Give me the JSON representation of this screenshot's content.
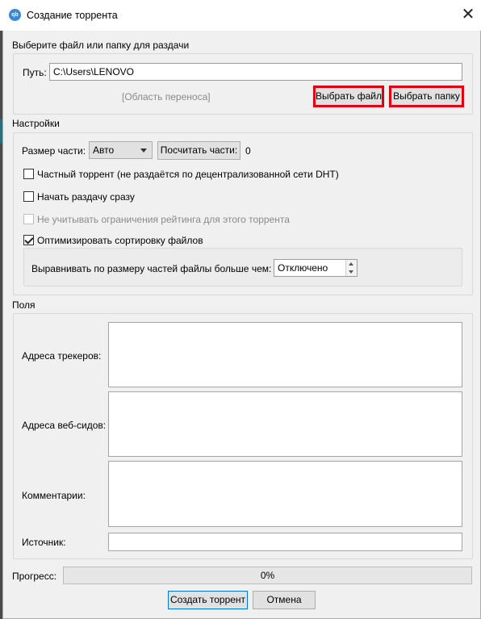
{
  "window": {
    "title": "Создание торрента",
    "icon_text": "qb"
  },
  "source": {
    "heading": "Выберите файл или папку для раздачи",
    "path_label": "Путь:",
    "path_value": "C:\\Users\\LENOVO",
    "drop_area": "[Область переноса]",
    "select_file": "Выбрать файл",
    "select_folder": "Выбрать папку",
    "highlight_color": "#e00012"
  },
  "settings": {
    "heading": "Настройки",
    "piece_size_label": "Размер части:",
    "piece_size_value": "Авто",
    "calc_pieces": "Посчитать части:",
    "pieces_count": "0",
    "private_torrent": "Частный торрент (не раздаётся по децентрализованной сети DHT)",
    "start_seeding": "Начать раздачу сразу",
    "ignore_ratio": "Не учитывать ограничения рейтинга для этого торрента",
    "optimize_alignment": "Оптимизировать сортировку файлов",
    "align_label": "Выравнивать по размеру частей файлы больше чем:",
    "align_value": "Отключено",
    "checked": {
      "private_torrent": false,
      "start_seeding": false,
      "ignore_ratio": false,
      "optimize_alignment": true
    }
  },
  "fields": {
    "heading": "Поля",
    "trackers": "Адреса трекеров:",
    "web_seeds": "Адреса веб-сидов:",
    "comments": "Комментарии:",
    "source": "Источник:"
  },
  "footer": {
    "progress_label": "Прогресс:",
    "progress_value": "0%",
    "progress_fraction": 0,
    "create": "Создать торрент",
    "cancel": "Отмена"
  }
}
